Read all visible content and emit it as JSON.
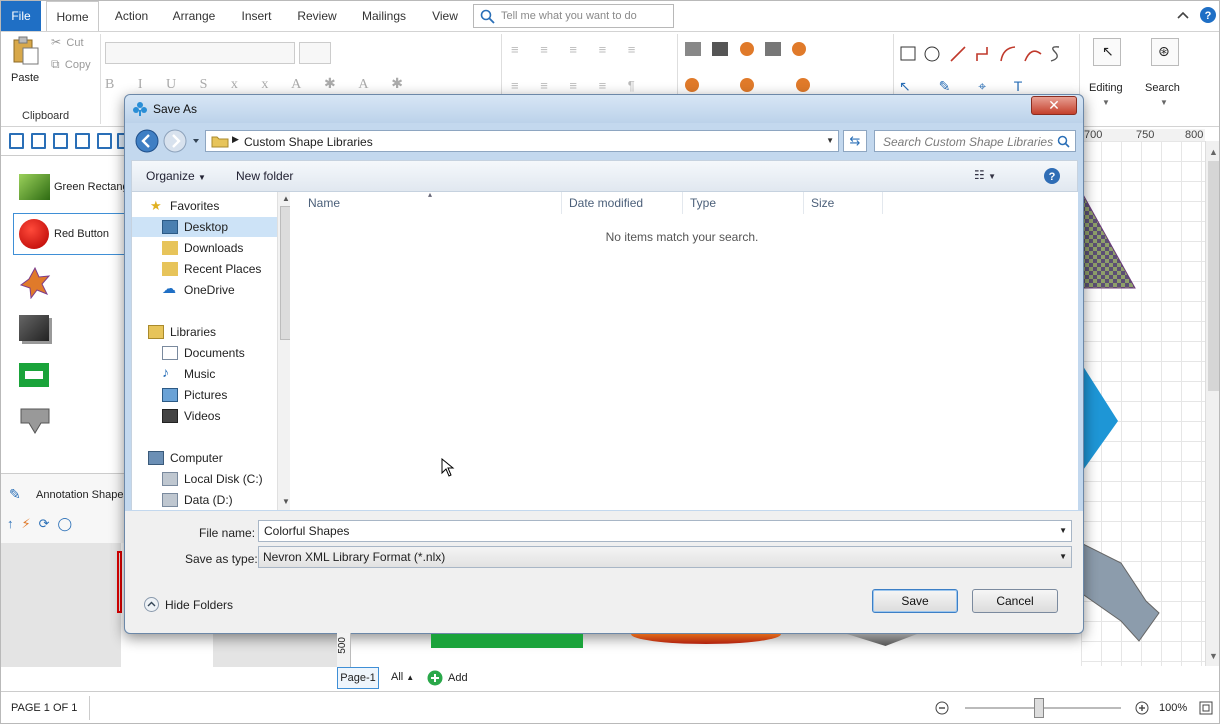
{
  "ribbon": {
    "tabs": [
      "File",
      "Home",
      "Action",
      "Arrange",
      "Insert",
      "Review",
      "Mailings",
      "View"
    ],
    "tell_me_placeholder": "Tell me what you want to do",
    "clipboard": {
      "paste": "Paste",
      "cut": "Cut",
      "copy": "Copy",
      "group": "Clipboard"
    },
    "editing_label": "Editing",
    "search_label": "Search"
  },
  "library": {
    "items": [
      "Green Rectangle",
      "Red Button"
    ],
    "annotation_title": "Annotation Shapes"
  },
  "ruler": {
    "ticks": [
      "700",
      "750",
      "800"
    ]
  },
  "vertical_ruler_label": "500",
  "pagebar": {
    "page_tab": "Page-1",
    "all_label": "All",
    "add_label": "Add"
  },
  "status": {
    "page_info": "PAGE 1 OF 1",
    "zoom": "100%",
    "zoom_level": 0.5
  },
  "dialog": {
    "title": "Save As",
    "path": "Custom Shape Libraries",
    "search_placeholder": "Search Custom Shape Libraries",
    "organize_label": "Organize",
    "new_folder_label": "New folder",
    "nav": {
      "favorites": "Favorites",
      "desktop": "Desktop",
      "downloads": "Downloads",
      "recent_places": "Recent Places",
      "onedrive": "OneDrive",
      "libraries": "Libraries",
      "documents": "Documents",
      "music": "Music",
      "pictures": "Pictures",
      "videos": "Videos",
      "computer": "Computer",
      "local_disk": "Local Disk (C:)",
      "data_disk": "Data (D:)"
    },
    "columns": {
      "name": "Name",
      "date_modified": "Date modified",
      "type": "Type",
      "size": "Size"
    },
    "empty_message": "No items match your search.",
    "file_name_label": "File name:",
    "file_name_value": "Colorful Shapes",
    "save_type_label": "Save as type:",
    "save_type_value": "Nevron XML Library Format (*.nlx)",
    "hide_folders_label": "Hide Folders",
    "save_label": "Save",
    "cancel_label": "Cancel"
  },
  "colors": {
    "accent": "#1f6fc5",
    "dialog_frame": "#c3d8ee",
    "close": "#c4402c"
  }
}
